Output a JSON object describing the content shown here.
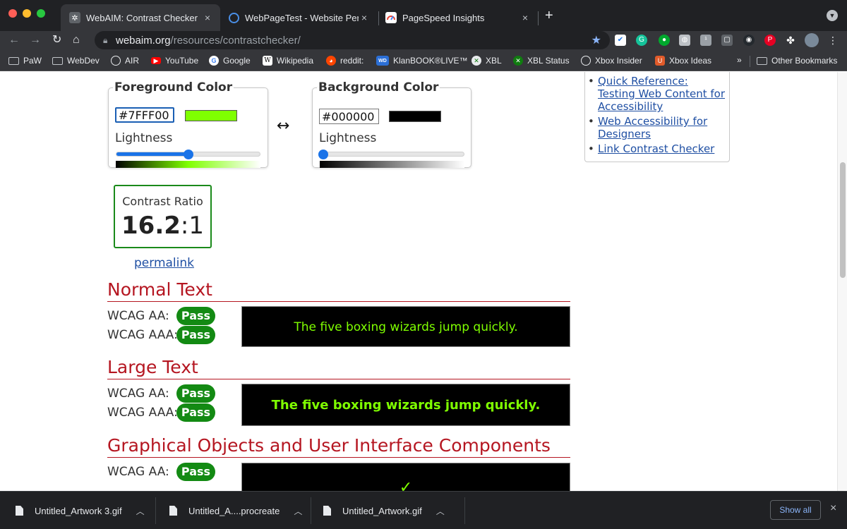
{
  "browser": {
    "tabs": [
      {
        "title": "WebAIM: Contrast Checker",
        "close": "×",
        "icon": "gear-favicon"
      },
      {
        "title": "WebPageTest - Website Perform",
        "close": "×",
        "icon": "globe-favicon"
      },
      {
        "title": "PageSpeed Insights",
        "close": "×",
        "icon": "pagespeed-favicon"
      }
    ],
    "new_tab": "+",
    "url_host": "webaim.org",
    "url_path": "/resources/contrastchecker/",
    "bookmarks": [
      {
        "label": "PaW",
        "icon": "folder-icon"
      },
      {
        "label": "WebDev",
        "icon": "folder-icon"
      },
      {
        "label": "AIR",
        "icon": "globe-icon"
      },
      {
        "label": "YouTube",
        "icon": "youtube-icon"
      },
      {
        "label": "Google",
        "icon": "google-icon"
      },
      {
        "label": "Wikipedia",
        "icon": "wikipedia-icon"
      },
      {
        "label": "reddit:",
        "icon": "reddit-icon"
      },
      {
        "label": "KlanBOOK®LIVE™",
        "icon": "wd-icon"
      },
      {
        "label": "XBL",
        "icon": "xbox-icon"
      },
      {
        "label": "XBL Status",
        "icon": "xbox-icon"
      },
      {
        "label": "Xbox Insider",
        "icon": "globe-icon"
      },
      {
        "label": "Xbox Ideas",
        "icon": "uservoice-icon"
      }
    ],
    "bookmarks_more": "»",
    "other_bookmarks": "Other Bookmarks"
  },
  "checker": {
    "foreground": {
      "legend": "Foreground Color",
      "hex": "#7FFF00",
      "swatch_color": "#7FFF00",
      "lightness_label": "Lightness",
      "lightness_fraction": 0.5
    },
    "background": {
      "legend": "Background Color",
      "hex": "#000000",
      "swatch_color": "#000000",
      "lightness_label": "Lightness",
      "lightness_fraction": 0.0
    },
    "swap_symbol": "↔",
    "contrast_label": "Contrast Ratio",
    "ratio_number": "16.2",
    "ratio_suffix": ":1",
    "permalink": "permalink"
  },
  "results": {
    "normal": {
      "heading": "Normal Text",
      "aa_label": "WCAG AA:",
      "aa_result": "Pass",
      "aaa_label": "WCAG AAA:",
      "aaa_result": "Pass",
      "sample": "The five boxing wizards jump quickly."
    },
    "large": {
      "heading": "Large Text",
      "aa_label": "WCAG AA:",
      "aa_result": "Pass",
      "aaa_label": "WCAG AAA:",
      "aaa_result": "Pass",
      "sample": "The five boxing wizards jump quickly."
    },
    "graphical": {
      "heading": "Graphical Objects and User Interface Components",
      "aa_label": "WCAG AA:",
      "aa_result": "Pass",
      "sample_icon": "✓"
    }
  },
  "sidebar": {
    "links": [
      "Quick Reference: Testing Web Content for Accessibility",
      "Web Accessibility for Designers",
      "Link Contrast Checker"
    ]
  },
  "downloads": {
    "items": [
      {
        "name": "Untitled_Artwork 3.gif"
      },
      {
        "name": "Untitled_A....procreate"
      },
      {
        "name": "Untitled_Artwork.gif"
      }
    ],
    "show_all": "Show all",
    "close": "×"
  },
  "colors": {
    "accent_red": "#b51621",
    "pass_green": "#138a13",
    "link_blue": "#1f4fa3",
    "slider_blue": "#1a73e8"
  }
}
